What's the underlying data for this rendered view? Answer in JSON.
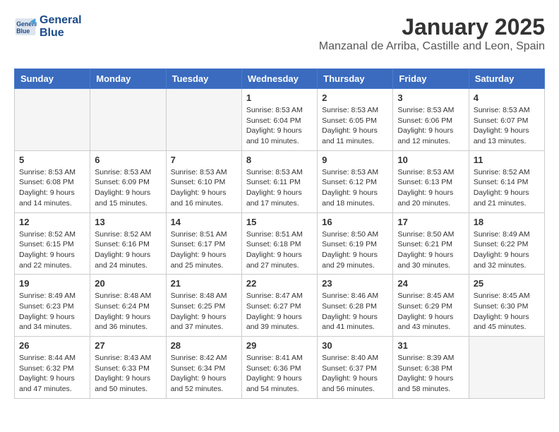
{
  "header": {
    "logo_line1": "General",
    "logo_line2": "Blue",
    "month_title": "January 2025",
    "location": "Manzanal de Arriba, Castille and Leon, Spain"
  },
  "days_of_week": [
    "Sunday",
    "Monday",
    "Tuesday",
    "Wednesday",
    "Thursday",
    "Friday",
    "Saturday"
  ],
  "weeks": [
    {
      "days": [
        {
          "number": "",
          "info": ""
        },
        {
          "number": "",
          "info": ""
        },
        {
          "number": "",
          "info": ""
        },
        {
          "number": "1",
          "info": "Sunrise: 8:53 AM\nSunset: 6:04 PM\nDaylight: 9 hours\nand 10 minutes."
        },
        {
          "number": "2",
          "info": "Sunrise: 8:53 AM\nSunset: 6:05 PM\nDaylight: 9 hours\nand 11 minutes."
        },
        {
          "number": "3",
          "info": "Sunrise: 8:53 AM\nSunset: 6:06 PM\nDaylight: 9 hours\nand 12 minutes."
        },
        {
          "number": "4",
          "info": "Sunrise: 8:53 AM\nSunset: 6:07 PM\nDaylight: 9 hours\nand 13 minutes."
        }
      ]
    },
    {
      "days": [
        {
          "number": "5",
          "info": "Sunrise: 8:53 AM\nSunset: 6:08 PM\nDaylight: 9 hours\nand 14 minutes."
        },
        {
          "number": "6",
          "info": "Sunrise: 8:53 AM\nSunset: 6:09 PM\nDaylight: 9 hours\nand 15 minutes."
        },
        {
          "number": "7",
          "info": "Sunrise: 8:53 AM\nSunset: 6:10 PM\nDaylight: 9 hours\nand 16 minutes."
        },
        {
          "number": "8",
          "info": "Sunrise: 8:53 AM\nSunset: 6:11 PM\nDaylight: 9 hours\nand 17 minutes."
        },
        {
          "number": "9",
          "info": "Sunrise: 8:53 AM\nSunset: 6:12 PM\nDaylight: 9 hours\nand 18 minutes."
        },
        {
          "number": "10",
          "info": "Sunrise: 8:53 AM\nSunset: 6:13 PM\nDaylight: 9 hours\nand 20 minutes."
        },
        {
          "number": "11",
          "info": "Sunrise: 8:52 AM\nSunset: 6:14 PM\nDaylight: 9 hours\nand 21 minutes."
        }
      ]
    },
    {
      "days": [
        {
          "number": "12",
          "info": "Sunrise: 8:52 AM\nSunset: 6:15 PM\nDaylight: 9 hours\nand 22 minutes."
        },
        {
          "number": "13",
          "info": "Sunrise: 8:52 AM\nSunset: 6:16 PM\nDaylight: 9 hours\nand 24 minutes."
        },
        {
          "number": "14",
          "info": "Sunrise: 8:51 AM\nSunset: 6:17 PM\nDaylight: 9 hours\nand 25 minutes."
        },
        {
          "number": "15",
          "info": "Sunrise: 8:51 AM\nSunset: 6:18 PM\nDaylight: 9 hours\nand 27 minutes."
        },
        {
          "number": "16",
          "info": "Sunrise: 8:50 AM\nSunset: 6:19 PM\nDaylight: 9 hours\nand 29 minutes."
        },
        {
          "number": "17",
          "info": "Sunrise: 8:50 AM\nSunset: 6:21 PM\nDaylight: 9 hours\nand 30 minutes."
        },
        {
          "number": "18",
          "info": "Sunrise: 8:49 AM\nSunset: 6:22 PM\nDaylight: 9 hours\nand 32 minutes."
        }
      ]
    },
    {
      "days": [
        {
          "number": "19",
          "info": "Sunrise: 8:49 AM\nSunset: 6:23 PM\nDaylight: 9 hours\nand 34 minutes."
        },
        {
          "number": "20",
          "info": "Sunrise: 8:48 AM\nSunset: 6:24 PM\nDaylight: 9 hours\nand 36 minutes."
        },
        {
          "number": "21",
          "info": "Sunrise: 8:48 AM\nSunset: 6:25 PM\nDaylight: 9 hours\nand 37 minutes."
        },
        {
          "number": "22",
          "info": "Sunrise: 8:47 AM\nSunset: 6:27 PM\nDaylight: 9 hours\nand 39 minutes."
        },
        {
          "number": "23",
          "info": "Sunrise: 8:46 AM\nSunset: 6:28 PM\nDaylight: 9 hours\nand 41 minutes."
        },
        {
          "number": "24",
          "info": "Sunrise: 8:45 AM\nSunset: 6:29 PM\nDaylight: 9 hours\nand 43 minutes."
        },
        {
          "number": "25",
          "info": "Sunrise: 8:45 AM\nSunset: 6:30 PM\nDaylight: 9 hours\nand 45 minutes."
        }
      ]
    },
    {
      "days": [
        {
          "number": "26",
          "info": "Sunrise: 8:44 AM\nSunset: 6:32 PM\nDaylight: 9 hours\nand 47 minutes."
        },
        {
          "number": "27",
          "info": "Sunrise: 8:43 AM\nSunset: 6:33 PM\nDaylight: 9 hours\nand 50 minutes."
        },
        {
          "number": "28",
          "info": "Sunrise: 8:42 AM\nSunset: 6:34 PM\nDaylight: 9 hours\nand 52 minutes."
        },
        {
          "number": "29",
          "info": "Sunrise: 8:41 AM\nSunset: 6:36 PM\nDaylight: 9 hours\nand 54 minutes."
        },
        {
          "number": "30",
          "info": "Sunrise: 8:40 AM\nSunset: 6:37 PM\nDaylight: 9 hours\nand 56 minutes."
        },
        {
          "number": "31",
          "info": "Sunrise: 8:39 AM\nSunset: 6:38 PM\nDaylight: 9 hours\nand 58 minutes."
        },
        {
          "number": "",
          "info": ""
        }
      ]
    }
  ]
}
